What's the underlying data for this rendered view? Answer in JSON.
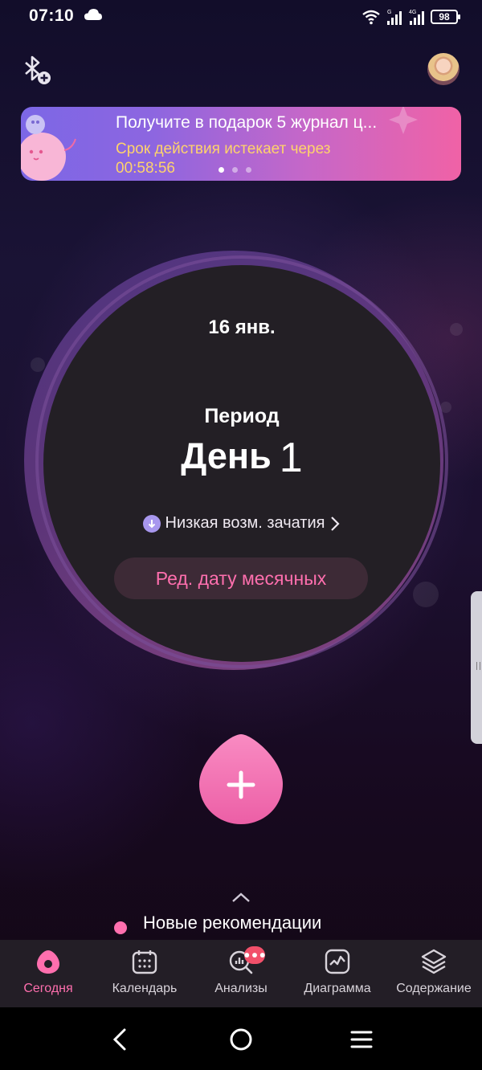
{
  "status_bar": {
    "time": "07:10",
    "battery": "98",
    "network_g": "G",
    "network_4g": "4G"
  },
  "banner": {
    "title": "Получите в подарок 5 журнал ц...",
    "subtitle": "Срок действия истекает через",
    "countdown": "00:58:56",
    "pages": 3,
    "active_page": 1
  },
  "cycle": {
    "date": "16 янв.",
    "phase": "Период",
    "day_label": "День",
    "day_number": "1",
    "fertility_text": "Низкая возм. зачатия",
    "edit_button": "Ред. дату месячных"
  },
  "recommendations": {
    "label": "Новые рекомендации"
  },
  "tabs": [
    {
      "label": "Сегодня",
      "icon": "drop-icon",
      "active": true
    },
    {
      "label": "Календарь",
      "icon": "calendar-icon",
      "active": false
    },
    {
      "label": "Анализы",
      "icon": "analysis-icon",
      "active": false,
      "badge": "···"
    },
    {
      "label": "Диаграмма",
      "icon": "chart-icon",
      "active": false
    },
    {
      "label": "Содержание",
      "icon": "layers-icon",
      "active": false
    }
  ],
  "colors": {
    "accent": "#ff6fae",
    "countdown": "#ffd36b",
    "tab_bar": "#231e26",
    "circle": "#231f25"
  }
}
